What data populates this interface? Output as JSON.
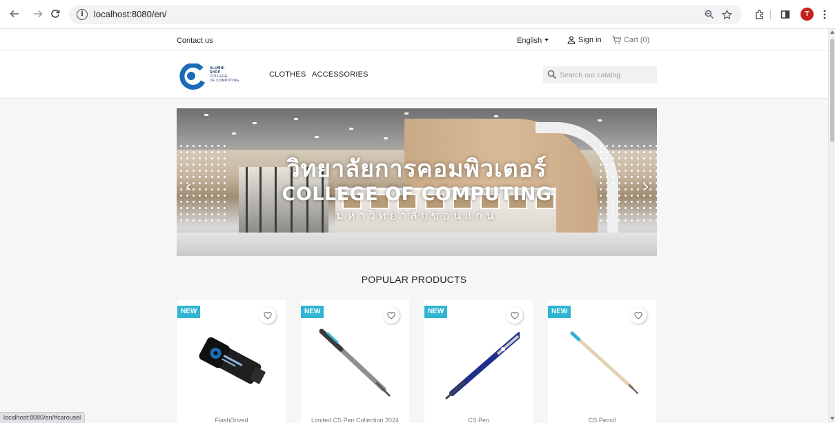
{
  "browser": {
    "url": "localhost:8080/en/",
    "status_url": "localhost:8080/en/#carousel",
    "profile_initial": "T",
    "accent_color": "#c5221f"
  },
  "header": {
    "contact_label": "Contact us",
    "language_label": "English",
    "signin_label": "Sign in",
    "cart_label": "Cart (0)"
  },
  "logo": {
    "line1": "ALUMNI",
    "line2": "SHOP",
    "line3": "COLLEGE",
    "line4": "OF COMPUTING"
  },
  "menu": {
    "items": [
      {
        "label": "CLOTHES"
      },
      {
        "label": "ACCESSORIES"
      }
    ]
  },
  "search": {
    "placeholder": "Search our catalog"
  },
  "carousel": {
    "title_thai": "วิทยาลัยการคอมพิวเตอร์",
    "title_en": "COLLEGE OF COMPUTING",
    "subtitle_thai": "มหาวิทยาลัยขอนแก่น"
  },
  "popular": {
    "title": "POPULAR PRODUCTS",
    "badge_label": "NEW",
    "badge_color": "#2fb5d2",
    "products": [
      {
        "name": "FlashDrived"
      },
      {
        "name": "Limited CS Pen Collection 2024"
      },
      {
        "name": "CS Pen"
      },
      {
        "name": "CS Pencil"
      }
    ]
  }
}
